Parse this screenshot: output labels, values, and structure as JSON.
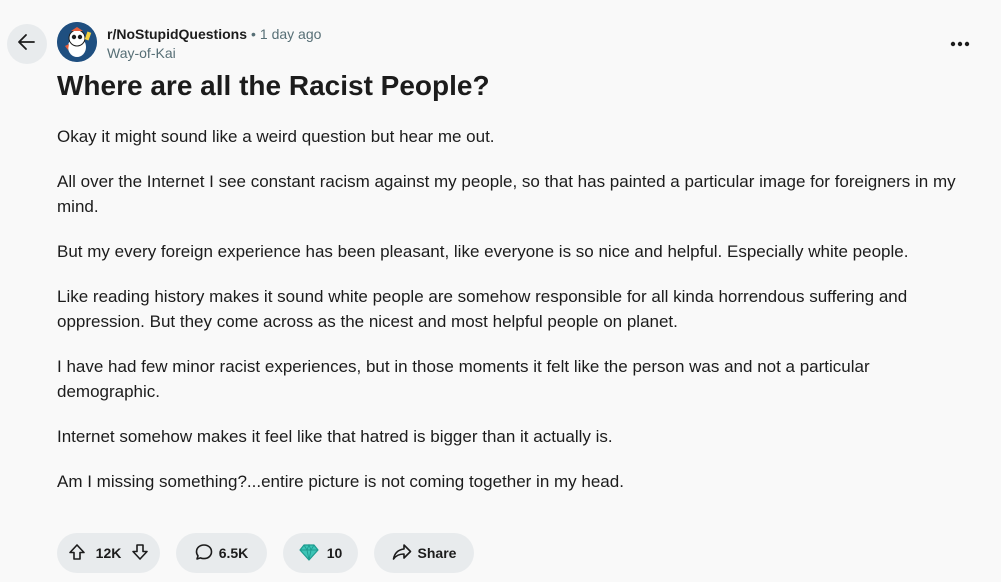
{
  "post": {
    "subreddit": "r/NoStupidQuestions",
    "separator": "•",
    "time_ago": "1 day ago",
    "author": "Way-of-Kai",
    "title": "Where are all the Racist People?",
    "paragraphs": [
      "Okay it might sound like a weird question but hear me out.",
      "All over the Internet I see constant racism against my people, so that has painted a particular image for foreigners in my mind.",
      "But my every foreign experience has been pleasant, like everyone is so nice and helpful. Especially white people.",
      "Like reading history makes it sound white people are somehow responsible for all kinda horrendous suffering and oppression. But they come across as the nicest and most helpful people on planet.",
      "I have had few minor racist experiences, but in those moments it felt like the person was and not a particular demographic.",
      "Internet somehow makes it feel like that hatred is bigger than it actually is.",
      "Am I missing something?...entire picture is not coming together in my head."
    ]
  },
  "actions": {
    "votes": "12K",
    "comments": "6.5K",
    "awards": "10",
    "share_label": "Share"
  },
  "icons": {
    "back": "arrow-left-icon",
    "overflow": "ellipsis-icon",
    "upvote": "arrow-up-icon",
    "downvote": "arrow-down-icon",
    "comment": "speech-bubble-icon",
    "award": "diamond-icon",
    "share": "share-arrow-icon"
  },
  "colors": {
    "background": "#f9f9f9",
    "pill": "#e8ebed",
    "text": "#1c1c1c",
    "muted": "#576f76",
    "avatar": "#1f4f80",
    "award": "#2fb5a8"
  }
}
